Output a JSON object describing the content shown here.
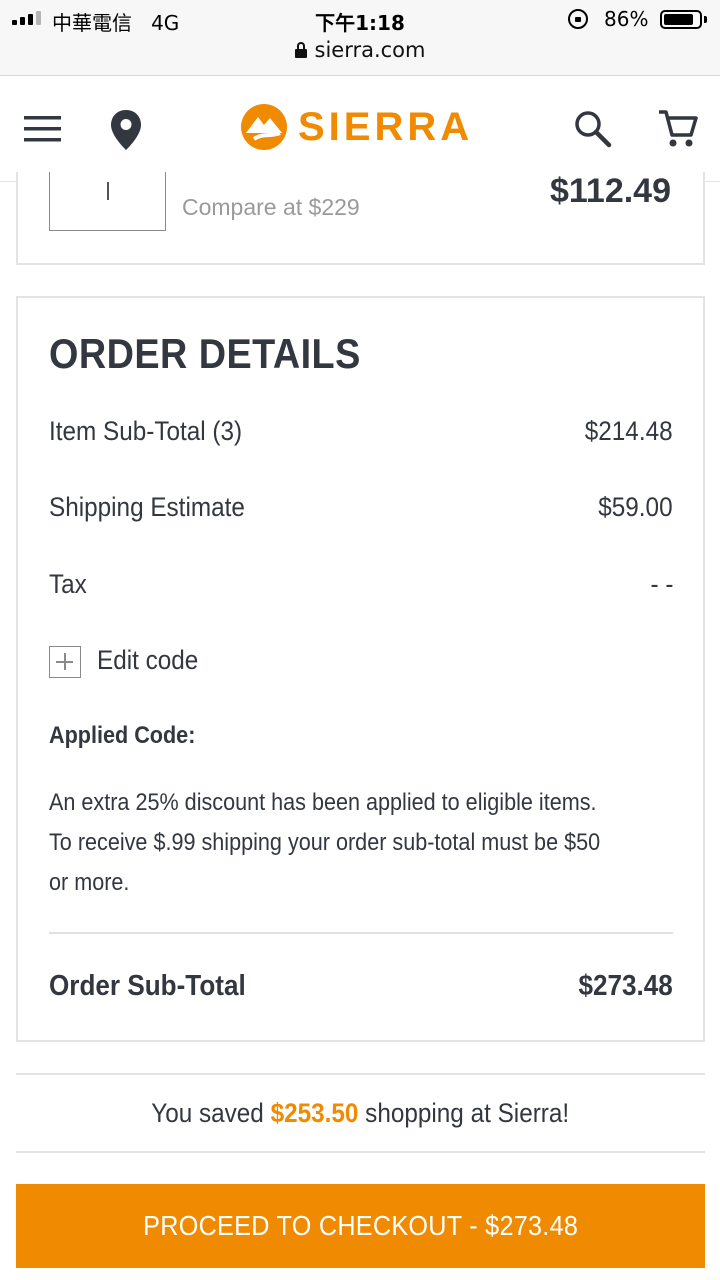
{
  "status_bar": {
    "carrier": "中華電信",
    "network": "4G",
    "time": "下午1:18",
    "battery_percent": "86%",
    "battery_level": 0.86
  },
  "browser": {
    "url": "sierra.com"
  },
  "header": {
    "brand": "SIERRA",
    "icons": [
      "menu-icon",
      "location-pin-icon",
      "search-icon",
      "cart-icon"
    ],
    "accent_color": "#f08a00"
  },
  "cart_item": {
    "quantity": "1",
    "compare_text": "Compare at $229",
    "price": "$112.49"
  },
  "order_details": {
    "title": "ORDER DETAILS",
    "rows": [
      {
        "label": "Item Sub-Total (3)",
        "value": "$214.48"
      },
      {
        "label": "Shipping Estimate",
        "value": "$59.00"
      },
      {
        "label": "Tax",
        "value": "- -"
      }
    ],
    "edit_code_label": "Edit code",
    "applied_code_label": "Applied Code:",
    "notes": [
      "An extra 25% discount has been applied to eligible items.",
      "To receive $.99 shipping your order sub-total must be $50",
      "or more."
    ],
    "subtotal_label": "Order Sub-Total",
    "subtotal_value": "$273.48"
  },
  "savings": {
    "prefix": "You saved ",
    "amount": "$253.50",
    "suffix": " shopping at Sierra!"
  },
  "checkout_button": {
    "label": "PROCEED TO CHECKOUT - $273.48"
  }
}
